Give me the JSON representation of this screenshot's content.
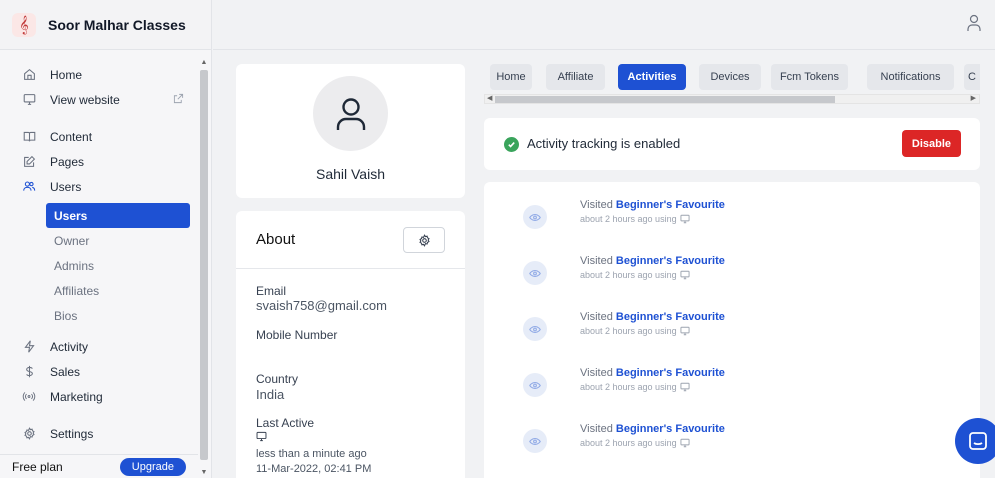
{
  "brand": {
    "name": "Soor Malhar Classes",
    "logo_icon": "treble-clef-icon"
  },
  "sidebar": {
    "items": [
      {
        "label": "Home",
        "icon": "home-icon"
      },
      {
        "label": "View website",
        "icon": "monitor-icon"
      },
      {
        "label": "Content",
        "icon": "book-icon"
      },
      {
        "label": "Pages",
        "icon": "edit-icon"
      },
      {
        "label": "Users",
        "icon": "users-icon"
      },
      {
        "label": "Activity",
        "icon": "activity-icon"
      },
      {
        "label": "Sales",
        "icon": "dollar-icon"
      },
      {
        "label": "Marketing",
        "icon": "broadcast-icon"
      },
      {
        "label": "Settings",
        "icon": "gear-icon"
      }
    ],
    "users_sub": [
      {
        "label": "Users",
        "active": true
      },
      {
        "label": "Owner"
      },
      {
        "label": "Admins"
      },
      {
        "label": "Affiliates"
      },
      {
        "label": "Bios"
      }
    ],
    "footer": {
      "plan": "Free plan",
      "upgrade": "Upgrade"
    }
  },
  "profile": {
    "name": "Sahil Vaish"
  },
  "about": {
    "title": "About",
    "email_label": "Email",
    "email": "svaish758@gmail.com",
    "mobile_label": "Mobile Number",
    "country_label": "Country",
    "country": "India",
    "last_active_label": "Last Active",
    "last_active_relative": "less than a minute ago",
    "last_active_date": "11-Mar-2022, 02:41 PM"
  },
  "tabs": [
    {
      "label": "Home"
    },
    {
      "label": "Affiliate"
    },
    {
      "label": "Activities",
      "active": true
    },
    {
      "label": "Devices"
    },
    {
      "label": "Fcm Tokens"
    },
    {
      "label": "Notifications"
    },
    {
      "label": "C"
    }
  ],
  "tracking": {
    "status_text": "Activity tracking is enabled",
    "disable_label": "Disable"
  },
  "activities": [
    {
      "prefix": "Visited",
      "target": "Beginner's Favourite",
      "meta": "about 2 hours ago using"
    },
    {
      "prefix": "Visited",
      "target": "Beginner's Favourite",
      "meta": "about 2 hours ago using"
    },
    {
      "prefix": "Visited",
      "target": "Beginner's Favourite",
      "meta": "about 2 hours ago using"
    },
    {
      "prefix": "Visited",
      "target": "Beginner's Favourite",
      "meta": "about 2 hours ago using"
    },
    {
      "prefix": "Visited",
      "target": "Beginner's Favourite",
      "meta": "about 2 hours ago using"
    }
  ],
  "colors": {
    "accent": "#1e51d3",
    "danger": "#dc2626",
    "success": "#3aa45c"
  }
}
